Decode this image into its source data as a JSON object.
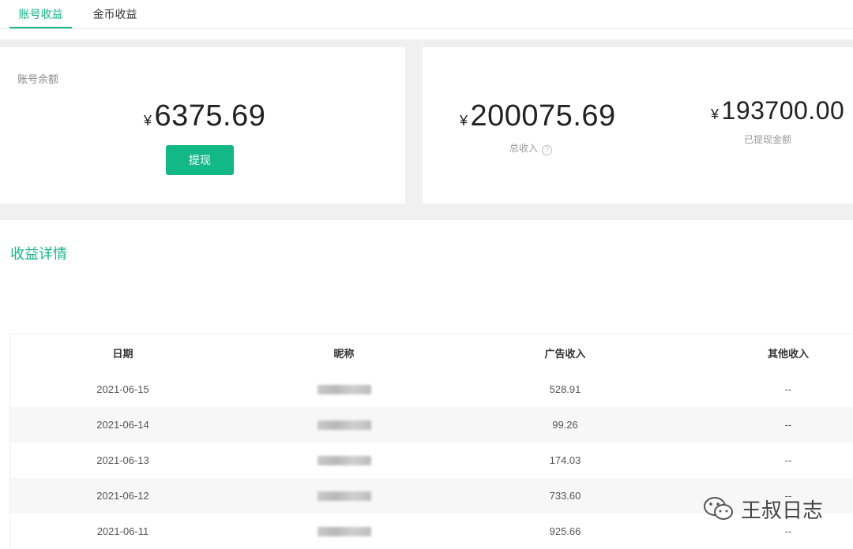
{
  "tabs": [
    {
      "label": "账号收益",
      "active": true
    },
    {
      "label": "金币收益",
      "active": false
    }
  ],
  "account": {
    "label": "账号余额",
    "currency": "¥",
    "balance": "6375.69",
    "withdraw_label": "提现"
  },
  "totals": {
    "currency": "¥",
    "total_income": "200075.69",
    "total_income_label": "总收入",
    "help_symbol": "?",
    "withdrawn": "193700.00",
    "withdrawn_label": "已提现金额"
  },
  "details": {
    "title": "收益详情",
    "columns": [
      "日期",
      "昵称",
      "广告收入",
      "其他收入"
    ],
    "rows": [
      {
        "date": "2021-06-15",
        "ad_income": "528.91",
        "other_income": "--"
      },
      {
        "date": "2021-06-14",
        "ad_income": "99.26",
        "other_income": "--"
      },
      {
        "date": "2021-06-13",
        "ad_income": "174.03",
        "other_income": "--"
      },
      {
        "date": "2021-06-12",
        "ad_income": "733.60",
        "other_income": "--"
      },
      {
        "date": "2021-06-11",
        "ad_income": "925.66",
        "other_income": "--"
      }
    ]
  },
  "watermark": {
    "text": "王叔日志",
    "icon": "wechat-icon"
  },
  "colors": {
    "accent": "#12b886",
    "band": "#f0f0f0"
  }
}
